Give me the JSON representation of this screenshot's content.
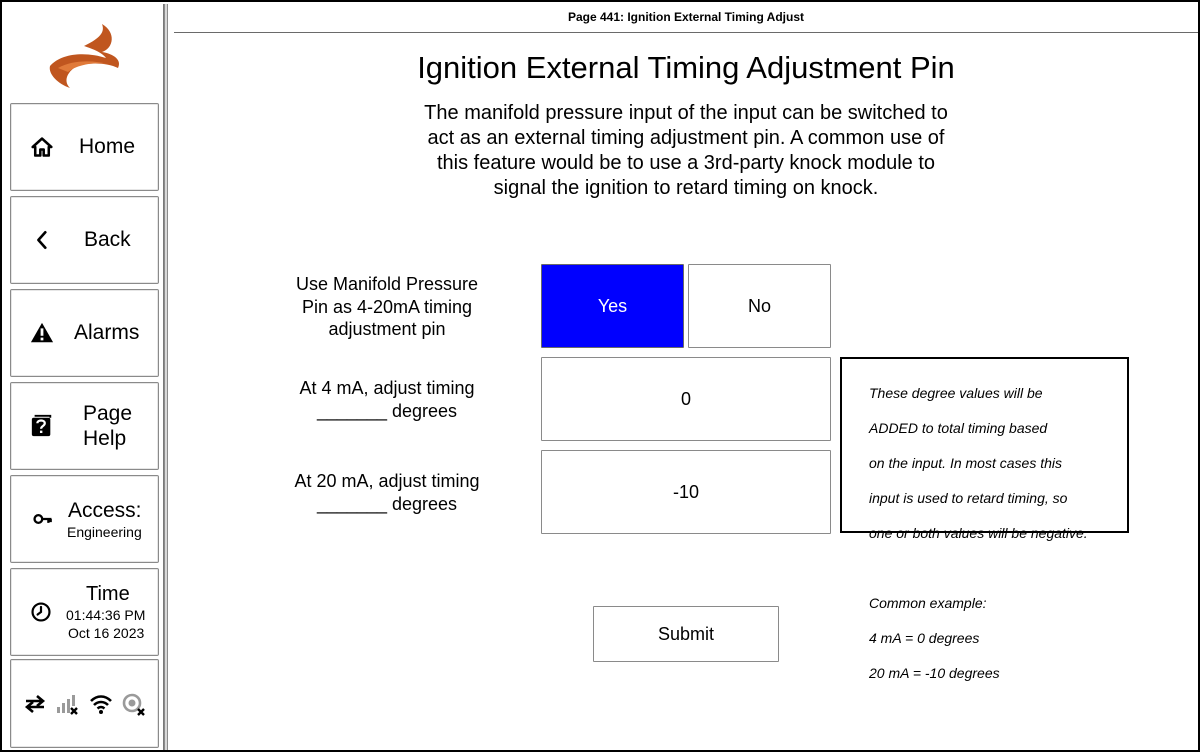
{
  "header": {
    "page_title": "Page 441: Ignition External Timing Adjust"
  },
  "sidebar": {
    "home": "Home",
    "back": "Back",
    "alarms": "Alarms",
    "page_help_line1": "Page",
    "page_help_line2": "Help",
    "access_label": "Access:",
    "access_level": "Engineering",
    "time_label": "Time",
    "time_value": "01:44:36 PM",
    "date_value": "Oct 16 2023",
    "status_icons": [
      "swap-arrows-icon",
      "signal-bars-disconnected-icon",
      "wifi-icon",
      "gps-disconnected-icon"
    ]
  },
  "main": {
    "title": "Ignition External Timing Adjustment Pin",
    "description_lines": [
      "The manifold pressure input of the input can be switched to",
      "act as an external timing adjustment pin. A common use of",
      "this feature would be to use a 3rd-party knock module to",
      "signal the ignition to retard timing on knock."
    ],
    "use_pin": {
      "label_lines": [
        "Use Manifold Pressure",
        "Pin as 4-20mA timing",
        "adjustment pin"
      ],
      "yes": "Yes",
      "no": "No",
      "selected": "Yes"
    },
    "at_4ma": {
      "label_lines": [
        "At 4 mA, adjust timing",
        "_______ degrees"
      ],
      "value": "0"
    },
    "at_20ma": {
      "label_lines": [
        "At 20 mA, adjust timing",
        "_______ degrees"
      ],
      "value": "-10"
    },
    "note_lines": [
      "These degree values will be",
      "ADDED to total timing based",
      "on the input. In most cases this",
      "input is used to retard timing, so",
      "one or both values will be negative.",
      "",
      "Common example:",
      "4 mA = 0 degrees",
      "20 mA = -10 degrees"
    ],
    "submit": "Submit"
  },
  "colors": {
    "accent_selected": "#0000ff",
    "logo_orange": "#c0561f"
  }
}
